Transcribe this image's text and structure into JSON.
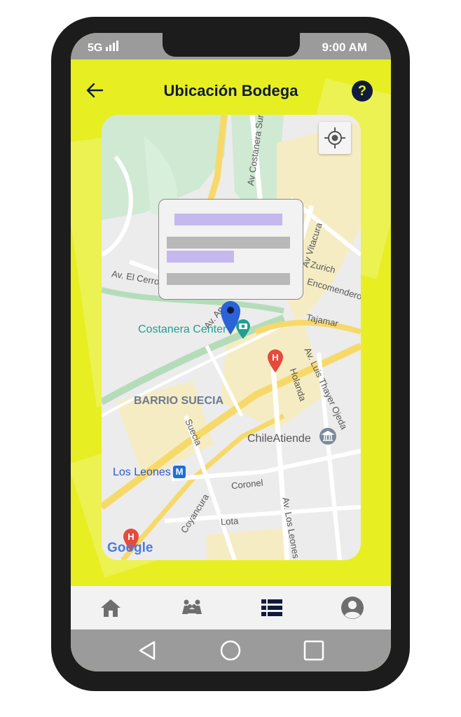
{
  "status_bar": {
    "network": "5G",
    "time": "9:00 AM"
  },
  "header": {
    "title": "Ubicación Bodega",
    "back_icon": "arrow-left-icon",
    "help_icon": "question-circle-icon",
    "help_glyph": "?"
  },
  "map": {
    "street_labels": {
      "av_costanera_sur": "Av Costanera Sur",
      "av_vitacura": "Av Vitacura",
      "zurich": "Zurich",
      "encomenderos": "Encomenderos",
      "tajamar": "Tajamar",
      "av_el_cerro": "Av. El Cerro",
      "av_an": "Av. An",
      "av_luis_thayer_ojeda": "Av. Luis Thayer Ojeda",
      "holanda": "Holanda",
      "suecia": "Suecia",
      "coronel": "Coronel",
      "coyancura": "Coyancura",
      "lota": "Lota",
      "av_los_leones": "Av. Los Leones"
    },
    "places": {
      "costanera": "Costanera Center",
      "barrio": "BARRIO SUECIA",
      "chileatiende": "ChileAtiende",
      "los_leones": "Los Leones"
    },
    "metro_badge": "M",
    "hospital_badge": "H",
    "attribution": "Google",
    "colors": {
      "teal": "#1f9e94",
      "blue_text": "#2f57c9",
      "metro": "#1e6fd9",
      "hospital": "#e54b3c",
      "pin": "#2a62d8"
    }
  },
  "nav": {
    "items": [
      {
        "name": "home",
        "icon": "home-icon"
      },
      {
        "name": "users",
        "icon": "users-icon"
      },
      {
        "name": "list",
        "icon": "list-icon",
        "active": true
      },
      {
        "name": "profile",
        "icon": "profile-icon"
      }
    ]
  },
  "system_nav": [
    "back-triangle-icon",
    "home-circle-icon",
    "recents-square-icon"
  ],
  "colors": {
    "accent": "#e7ef22",
    "navy": "#0f1b3d",
    "popup_placeholder_purple": "#c4b8ee",
    "popup_placeholder_gray": "#b8b8b8"
  }
}
